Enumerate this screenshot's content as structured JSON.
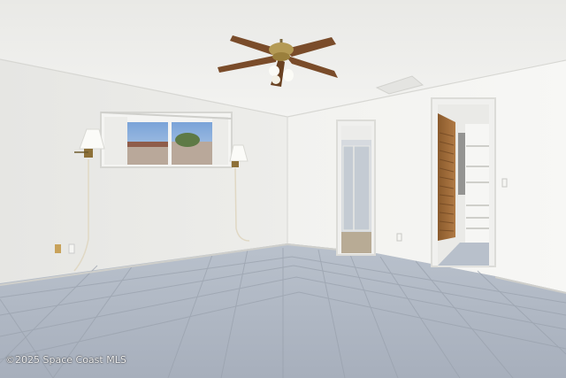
{
  "photo": {
    "subject": "empty-bedroom",
    "watermark": "©2025 Space Coast MLS"
  }
}
